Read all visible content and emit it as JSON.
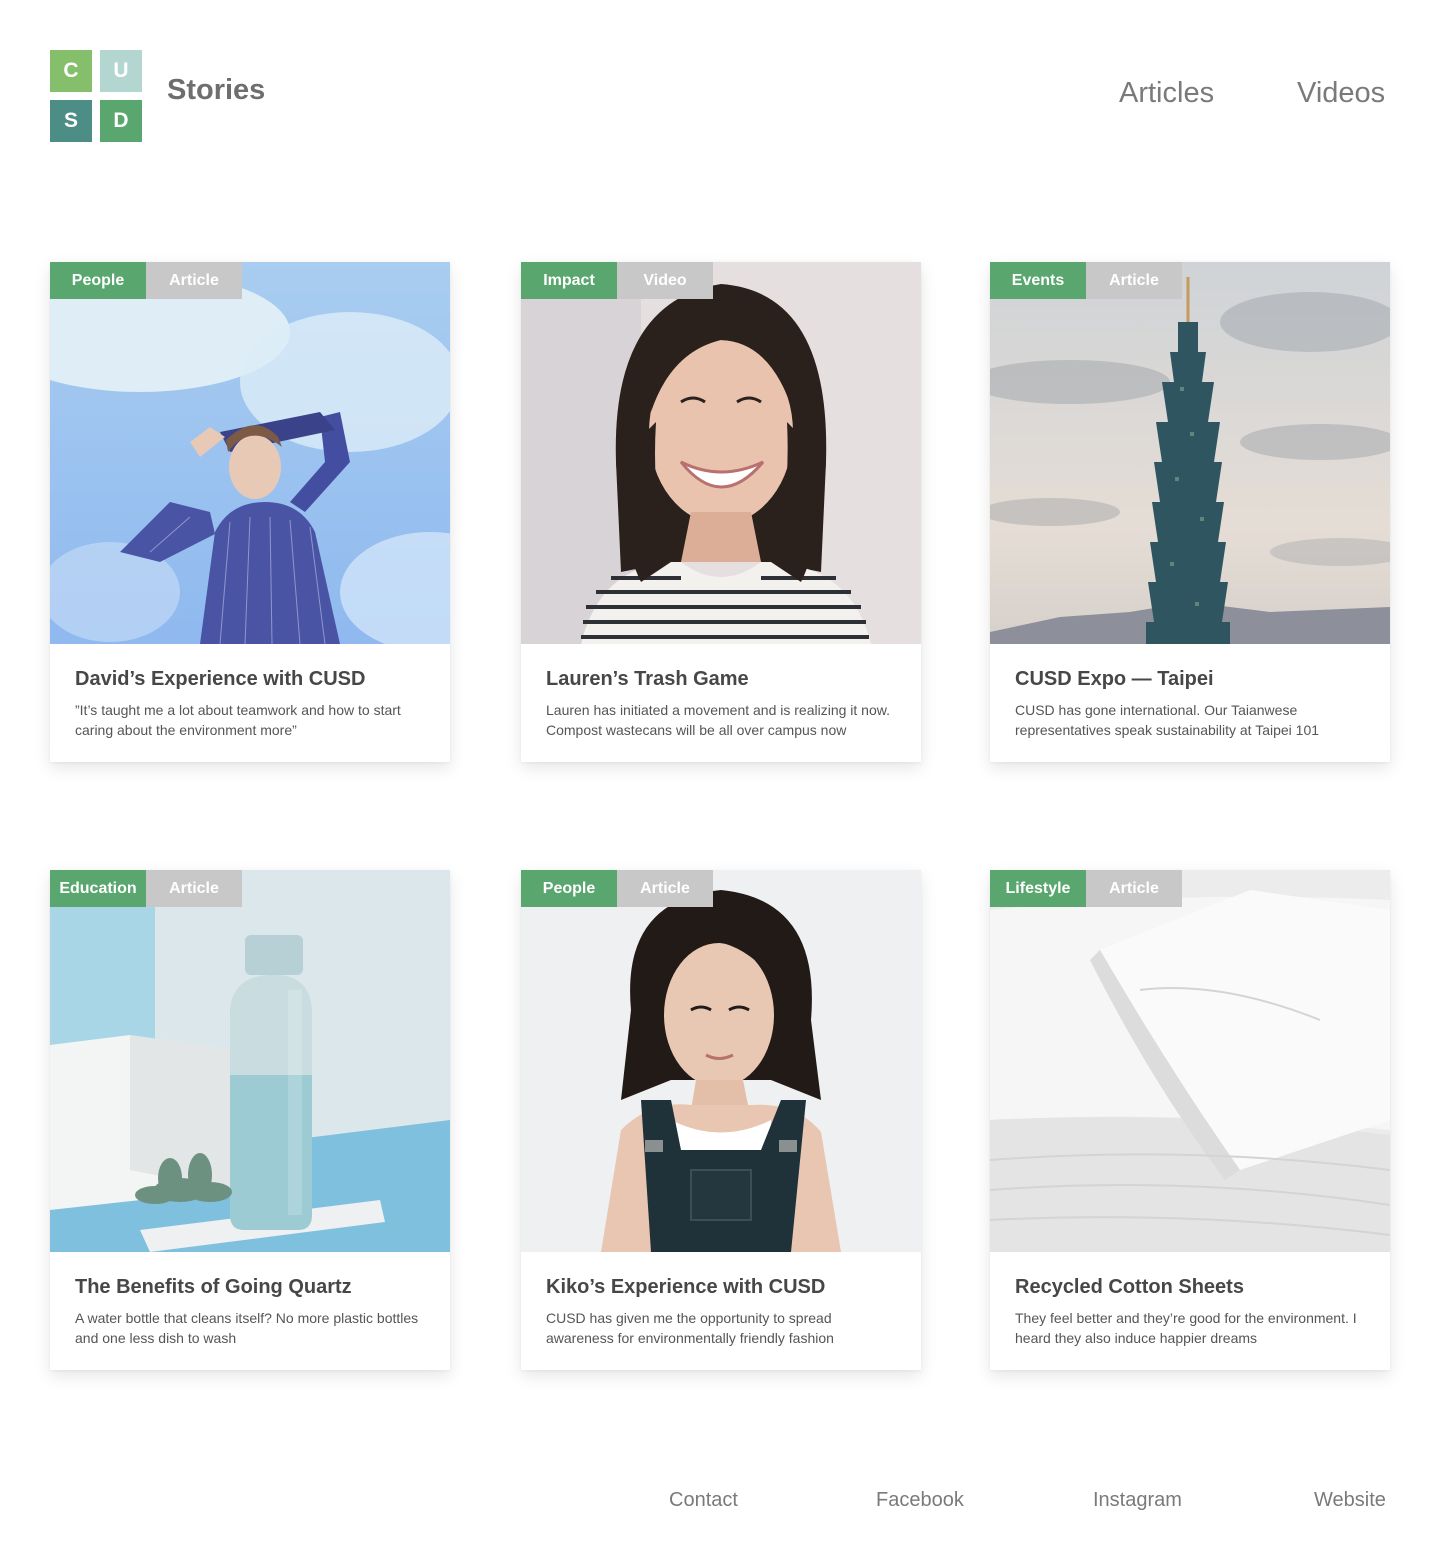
{
  "header": {
    "logo_letters": [
      "C",
      "U",
      "S",
      "D"
    ],
    "logo_colors": [
      "#86bf6c",
      "#b3d6d0",
      "#4c8d86",
      "#5aa66f"
    ],
    "brand_title": "Stories",
    "nav": [
      {
        "label": "Articles"
      },
      {
        "label": "Videos"
      }
    ]
  },
  "colors": {
    "category_tag": "#5aa66f",
    "type_tag": "#c8c8c8"
  },
  "cards": [
    {
      "category": "People",
      "type": "Article",
      "title": "David’s Experience with CUSD",
      "description": "”It’s taught me a lot about teamwork and how to start caring about the environment more”",
      "image": "photo-man-sky"
    },
    {
      "category": "Impact",
      "type": "Video",
      "title": "Lauren’s Trash Game",
      "description": "Lauren has initiated a movement and is realizing it now. Compost wastecans will be all over campus now",
      "image": "photo-smiling-woman"
    },
    {
      "category": "Events",
      "type": "Article",
      "title": "CUSD Expo — Taipei",
      "description": "CUSD has gone international. Our Taianwese representatives speak sustainability at Taipei 101",
      "image": "photo-taipei-101"
    },
    {
      "category": "Education",
      "type": "Article",
      "title": "The Benefits of Going Quartz",
      "description": "A water bottle that cleans itself? No more plastic bottles and one less dish to wash",
      "image": "photo-water-bottle"
    },
    {
      "category": "People",
      "type": "Article",
      "title": "Kiko’s Experience with CUSD",
      "description": "CUSD has given me the opportunity to spread awareness for environmentally friendly fashion",
      "image": "photo-woman-overalls"
    },
    {
      "category": "Lifestyle",
      "type": "Article",
      "title": "Recycled Cotton Sheets",
      "description": "They feel better and they’re good for the environment. I heard they also induce happier dreams",
      "image": "photo-cotton-sheets"
    }
  ],
  "footer": {
    "links": [
      {
        "label": "Contact"
      },
      {
        "label": "Facebook"
      },
      {
        "label": "Instagram"
      },
      {
        "label": "Website"
      }
    ]
  }
}
